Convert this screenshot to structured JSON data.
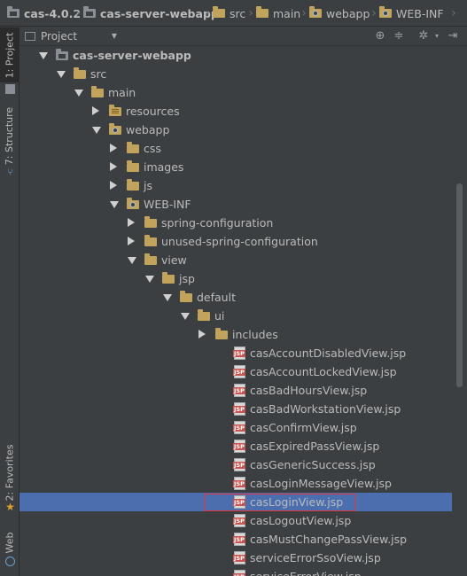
{
  "breadcrumb": [
    "cas-4.0.2",
    "cas-server-webapp",
    "src",
    "main",
    "webapp",
    "WEB-INF"
  ],
  "left_tabs": {
    "project": "1: Project",
    "structure": "7: Structure",
    "favorites": "2: Favorites",
    "web": "Web"
  },
  "toolbar": {
    "view_selector": "Project",
    "icons": [
      "target-icon",
      "collapse-icon",
      "gear-icon",
      "hide-icon"
    ]
  },
  "tree": [
    {
      "label": "cas-server-webapp",
      "arrow": "open",
      "icon": "module-folder",
      "bold": true
    },
    {
      "label": "src",
      "arrow": "open",
      "icon": "folder"
    },
    {
      "label": "main",
      "arrow": "open",
      "icon": "folder"
    },
    {
      "label": "resources",
      "arrow": "closed",
      "icon": "resources-folder"
    },
    {
      "label": "webapp",
      "arrow": "open",
      "icon": "web-folder"
    },
    {
      "label": "css",
      "arrow": "closed",
      "icon": "folder"
    },
    {
      "label": "images",
      "arrow": "closed",
      "icon": "folder"
    },
    {
      "label": "js",
      "arrow": "closed",
      "icon": "folder"
    },
    {
      "label": "WEB-INF",
      "arrow": "open",
      "icon": "web-folder"
    },
    {
      "label": "spring-configuration",
      "arrow": "closed",
      "icon": "folder"
    },
    {
      "label": "unused-spring-configuration",
      "arrow": "closed",
      "icon": "folder"
    },
    {
      "label": "view",
      "arrow": "open",
      "icon": "folder"
    },
    {
      "label": "jsp",
      "arrow": "open",
      "icon": "folder"
    },
    {
      "label": "default",
      "arrow": "open",
      "icon": "folder"
    },
    {
      "label": "ui",
      "arrow": "open",
      "icon": "folder"
    },
    {
      "label": "includes",
      "arrow": "closed",
      "icon": "folder"
    },
    {
      "label": "casAccountDisabledView.jsp",
      "icon": "jsp-file"
    },
    {
      "label": "casAccountLockedView.jsp",
      "icon": "jsp-file"
    },
    {
      "label": "casBadHoursView.jsp",
      "icon": "jsp-file"
    },
    {
      "label": "casBadWorkstationView.jsp",
      "icon": "jsp-file"
    },
    {
      "label": "casConfirmView.jsp",
      "icon": "jsp-file"
    },
    {
      "label": "casExpiredPassView.jsp",
      "icon": "jsp-file"
    },
    {
      "label": "casGenericSuccess.jsp",
      "icon": "jsp-file"
    },
    {
      "label": "casLoginMessageView.jsp",
      "icon": "jsp-file"
    },
    {
      "label": "casLoginView.jsp",
      "icon": "jsp-file",
      "selected": true
    },
    {
      "label": "casLogoutView.jsp",
      "icon": "jsp-file"
    },
    {
      "label": "casMustChangePassView.jsp",
      "icon": "jsp-file"
    },
    {
      "label": "serviceErrorSsoView.jsp",
      "icon": "jsp-file"
    },
    {
      "label": "serviceErrorView.jsp",
      "icon": "jsp-file"
    }
  ],
  "colors": {
    "selection": "#4b6eaf",
    "highlight_box": "#e0343f",
    "folder": "#c2a35c"
  }
}
